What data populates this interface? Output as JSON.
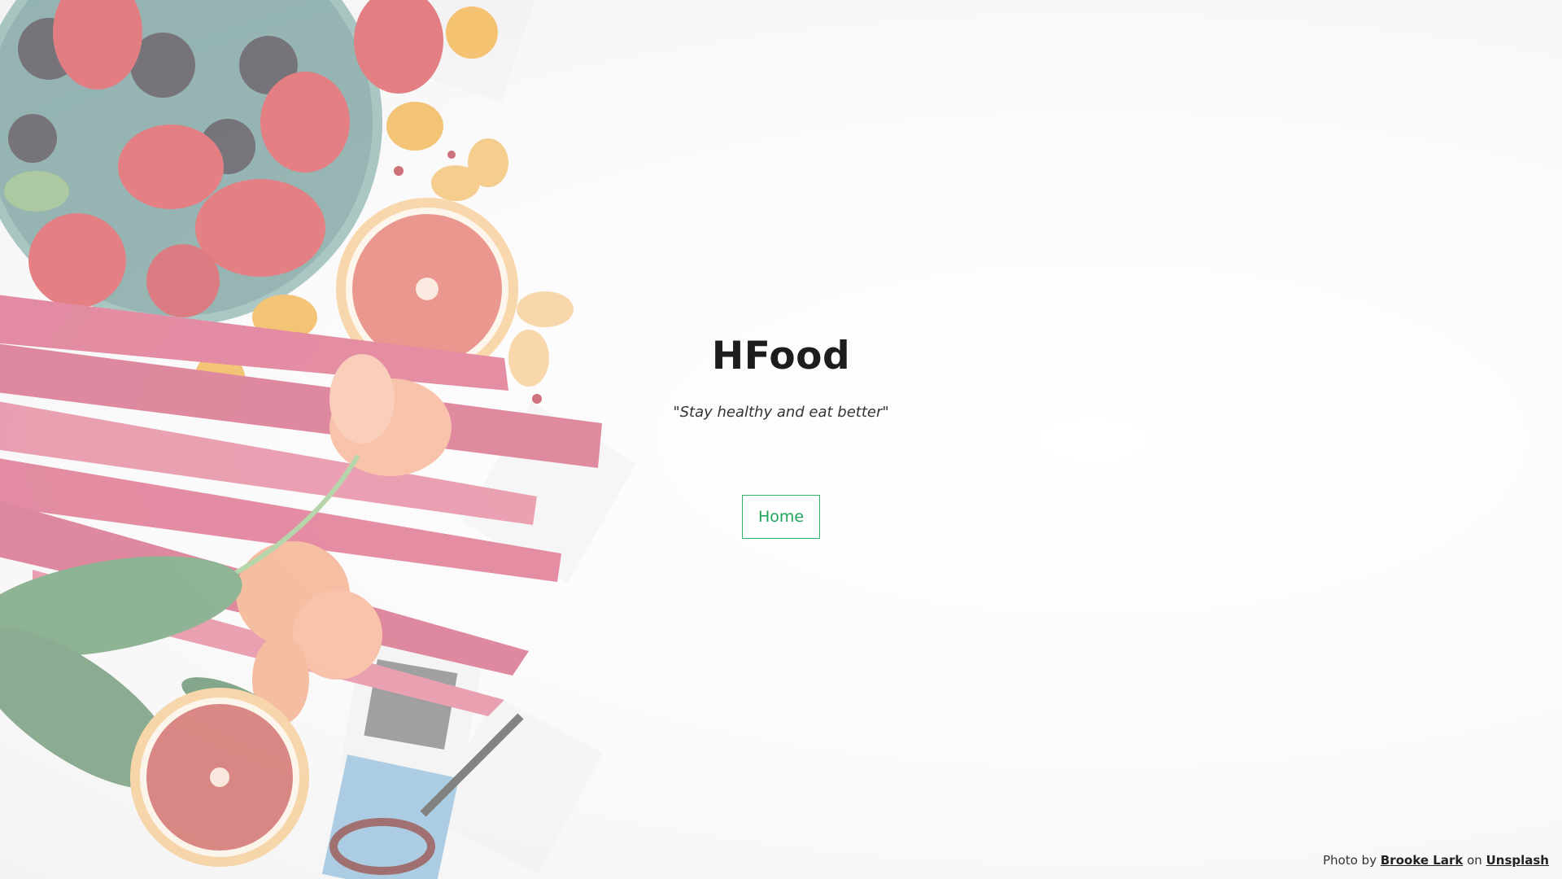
{
  "hero": {
    "title": "HFood",
    "tagline": "\"Stay healthy and eat better\"",
    "home_button": "Home"
  },
  "credit": {
    "prefix": "Photo by",
    "author": "Brooke Lark",
    "middle": "on",
    "source": "Unsplash"
  },
  "colors": {
    "accent": "#2fb066",
    "title": "#1d1d1d",
    "background": "#fbfbfb"
  },
  "background_image": "fruit-flatlay-photo"
}
